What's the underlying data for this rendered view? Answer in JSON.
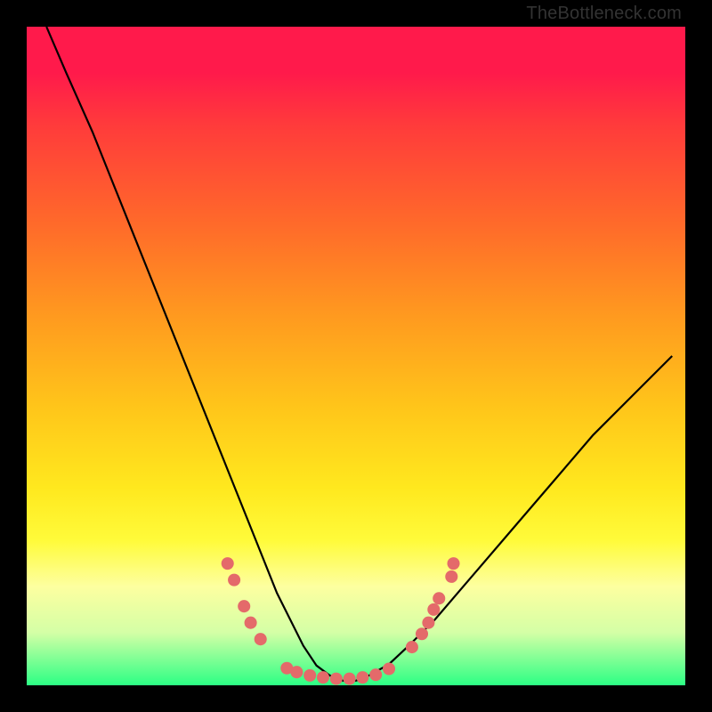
{
  "watermark": "TheBottleneck.com",
  "chart_data": {
    "type": "line",
    "title": "",
    "xlabel": "",
    "ylabel": "",
    "xlim": [
      0,
      100
    ],
    "ylim": [
      0,
      100
    ],
    "grid": false,
    "legend": false,
    "series": [
      {
        "name": "bottleneck-curve",
        "color": "#000000",
        "x": [
          3,
          6,
          10,
          14,
          18,
          22,
          26,
          30,
          34,
          36,
          38,
          40,
          42,
          44,
          46,
          48,
          50,
          52,
          55,
          58,
          62,
          68,
          74,
          80,
          86,
          92,
          98
        ],
        "y": [
          100,
          93,
          84,
          74,
          64,
          54,
          44,
          34,
          24,
          19,
          14,
          10,
          6,
          3,
          1.5,
          0.7,
          0.7,
          1.5,
          3.2,
          6,
          10,
          17,
          24,
          31,
          38,
          44,
          50
        ]
      }
    ],
    "markers": [
      {
        "x": 30.5,
        "y": 18.5
      },
      {
        "x": 31.5,
        "y": 16.0
      },
      {
        "x": 33.0,
        "y": 12.0
      },
      {
        "x": 34.0,
        "y": 9.5
      },
      {
        "x": 35.5,
        "y": 7.0
      },
      {
        "x": 39.5,
        "y": 2.6
      },
      {
        "x": 41.0,
        "y": 2.0
      },
      {
        "x": 43.0,
        "y": 1.5
      },
      {
        "x": 45.0,
        "y": 1.2
      },
      {
        "x": 47.0,
        "y": 1.0
      },
      {
        "x": 49.0,
        "y": 1.0
      },
      {
        "x": 51.0,
        "y": 1.2
      },
      {
        "x": 53.0,
        "y": 1.6
      },
      {
        "x": 55.0,
        "y": 2.5
      },
      {
        "x": 58.5,
        "y": 5.8
      },
      {
        "x": 60.0,
        "y": 7.8
      },
      {
        "x": 61.0,
        "y": 9.5
      },
      {
        "x": 61.8,
        "y": 11.5
      },
      {
        "x": 62.6,
        "y": 13.2
      },
      {
        "x": 64.5,
        "y": 16.5
      },
      {
        "x": 64.8,
        "y": 18.5
      }
    ],
    "marker_style": {
      "shape": "circle",
      "radius_pct": 0.95,
      "fill": "#e46a6a",
      "stroke": "none"
    },
    "background_gradient": {
      "direction": "vertical",
      "stops": [
        {
          "pos": 0.0,
          "color": "#ff1a4b"
        },
        {
          "pos": 0.3,
          "color": "#ff6a2a"
        },
        {
          "pos": 0.58,
          "color": "#ffc61a"
        },
        {
          "pos": 0.85,
          "color": "#fdffa0"
        },
        {
          "pos": 1.0,
          "color": "#2cff84"
        }
      ]
    }
  }
}
